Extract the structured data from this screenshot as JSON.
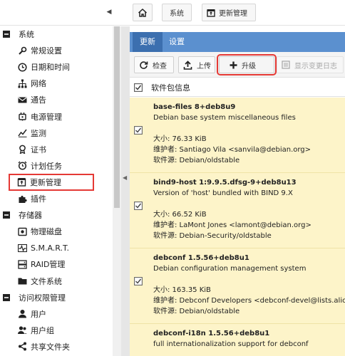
{
  "topbar": {
    "collapse_arrow": "◀",
    "breadcrumb_system": "系统",
    "breadcrumb_update": "更新管理"
  },
  "sidebar": {
    "items": [
      {
        "label": "系统",
        "kind": "group",
        "icon": "minus-square-icon"
      },
      {
        "label": "常规设置",
        "kind": "item",
        "icon": "wrench-icon"
      },
      {
        "label": "日期和时间",
        "kind": "item",
        "icon": "clock-icon"
      },
      {
        "label": "网络",
        "kind": "item",
        "icon": "network-icon"
      },
      {
        "label": "通告",
        "kind": "item",
        "icon": "envelope-icon"
      },
      {
        "label": "电源管理",
        "kind": "item",
        "icon": "power-plug-icon"
      },
      {
        "label": "监测",
        "kind": "item",
        "icon": "chart-line-icon"
      },
      {
        "label": "证书",
        "kind": "item",
        "icon": "certificate-icon"
      },
      {
        "label": "计划任务",
        "kind": "item",
        "icon": "alarm-clock-icon"
      },
      {
        "label": "更新管理",
        "kind": "item",
        "icon": "package-update-icon",
        "active": true
      },
      {
        "label": "插件",
        "kind": "item",
        "icon": "puzzle-icon"
      },
      {
        "label": "存储器",
        "kind": "group",
        "icon": "minus-square-icon"
      },
      {
        "label": "物理磁盘",
        "kind": "item",
        "icon": "disk-icon"
      },
      {
        "label": "S.M.A.R.T.",
        "kind": "item",
        "icon": "pulse-icon"
      },
      {
        "label": "RAID管理",
        "kind": "item",
        "icon": "raid-icon"
      },
      {
        "label": "文件系统",
        "kind": "item",
        "icon": "folder-icon"
      },
      {
        "label": "访问权限管理",
        "kind": "group",
        "icon": "minus-square-icon"
      },
      {
        "label": "用户",
        "kind": "item",
        "icon": "user-icon"
      },
      {
        "label": "用户组",
        "kind": "item",
        "icon": "users-icon"
      },
      {
        "label": "共享文件夹",
        "kind": "item",
        "icon": "share-icon"
      }
    ]
  },
  "main": {
    "tabs": [
      {
        "label": "更新"
      },
      {
        "label": "设置"
      }
    ],
    "toolbar": {
      "check_label": "检查",
      "upload_label": "上传",
      "upgrade_label": "升级",
      "changelog_label": "显示变更日志"
    },
    "table_header": "软件包信息",
    "packages": [
      {
        "name": "base-files 8+deb8u9",
        "desc": "Debian base system miscellaneous files",
        "size": "大小: 76.33 KiB",
        "maintainer": "维护者: Santiago Vila <sanvila@debian.org>",
        "source": "软件源: Debian/oldstable",
        "checked": true
      },
      {
        "name": "bind9-host 1:9.9.5.dfsg-9+deb8u13",
        "desc": "Version of 'host' bundled with BIND 9.X",
        "size": "大小: 66.52 KiB",
        "maintainer": "维护者: LaMont Jones <lamont@debian.org>",
        "source": "软件源: Debian-Security/oldstable",
        "checked": true
      },
      {
        "name": "debconf 1.5.56+deb8u1",
        "desc": "Debian configuration management system",
        "size": "大小: 163.35 KiB",
        "maintainer": "维护者: Debconf Developers <debconf-devel@lists.alioth.debian.org>",
        "source": "软件源: Debian/oldstable",
        "checked": true
      },
      {
        "name": "debconf-i18n 1.5.56+deb8u1",
        "desc": "full internationalization support for debconf",
        "size": "",
        "maintainer": "",
        "source": "",
        "checked": false
      }
    ]
  },
  "colors": {
    "tab_bar": "#5b90cf",
    "tab_active": "#3c6faf",
    "row_background": "#fdf4c9",
    "highlight_outline": "#e53935"
  }
}
